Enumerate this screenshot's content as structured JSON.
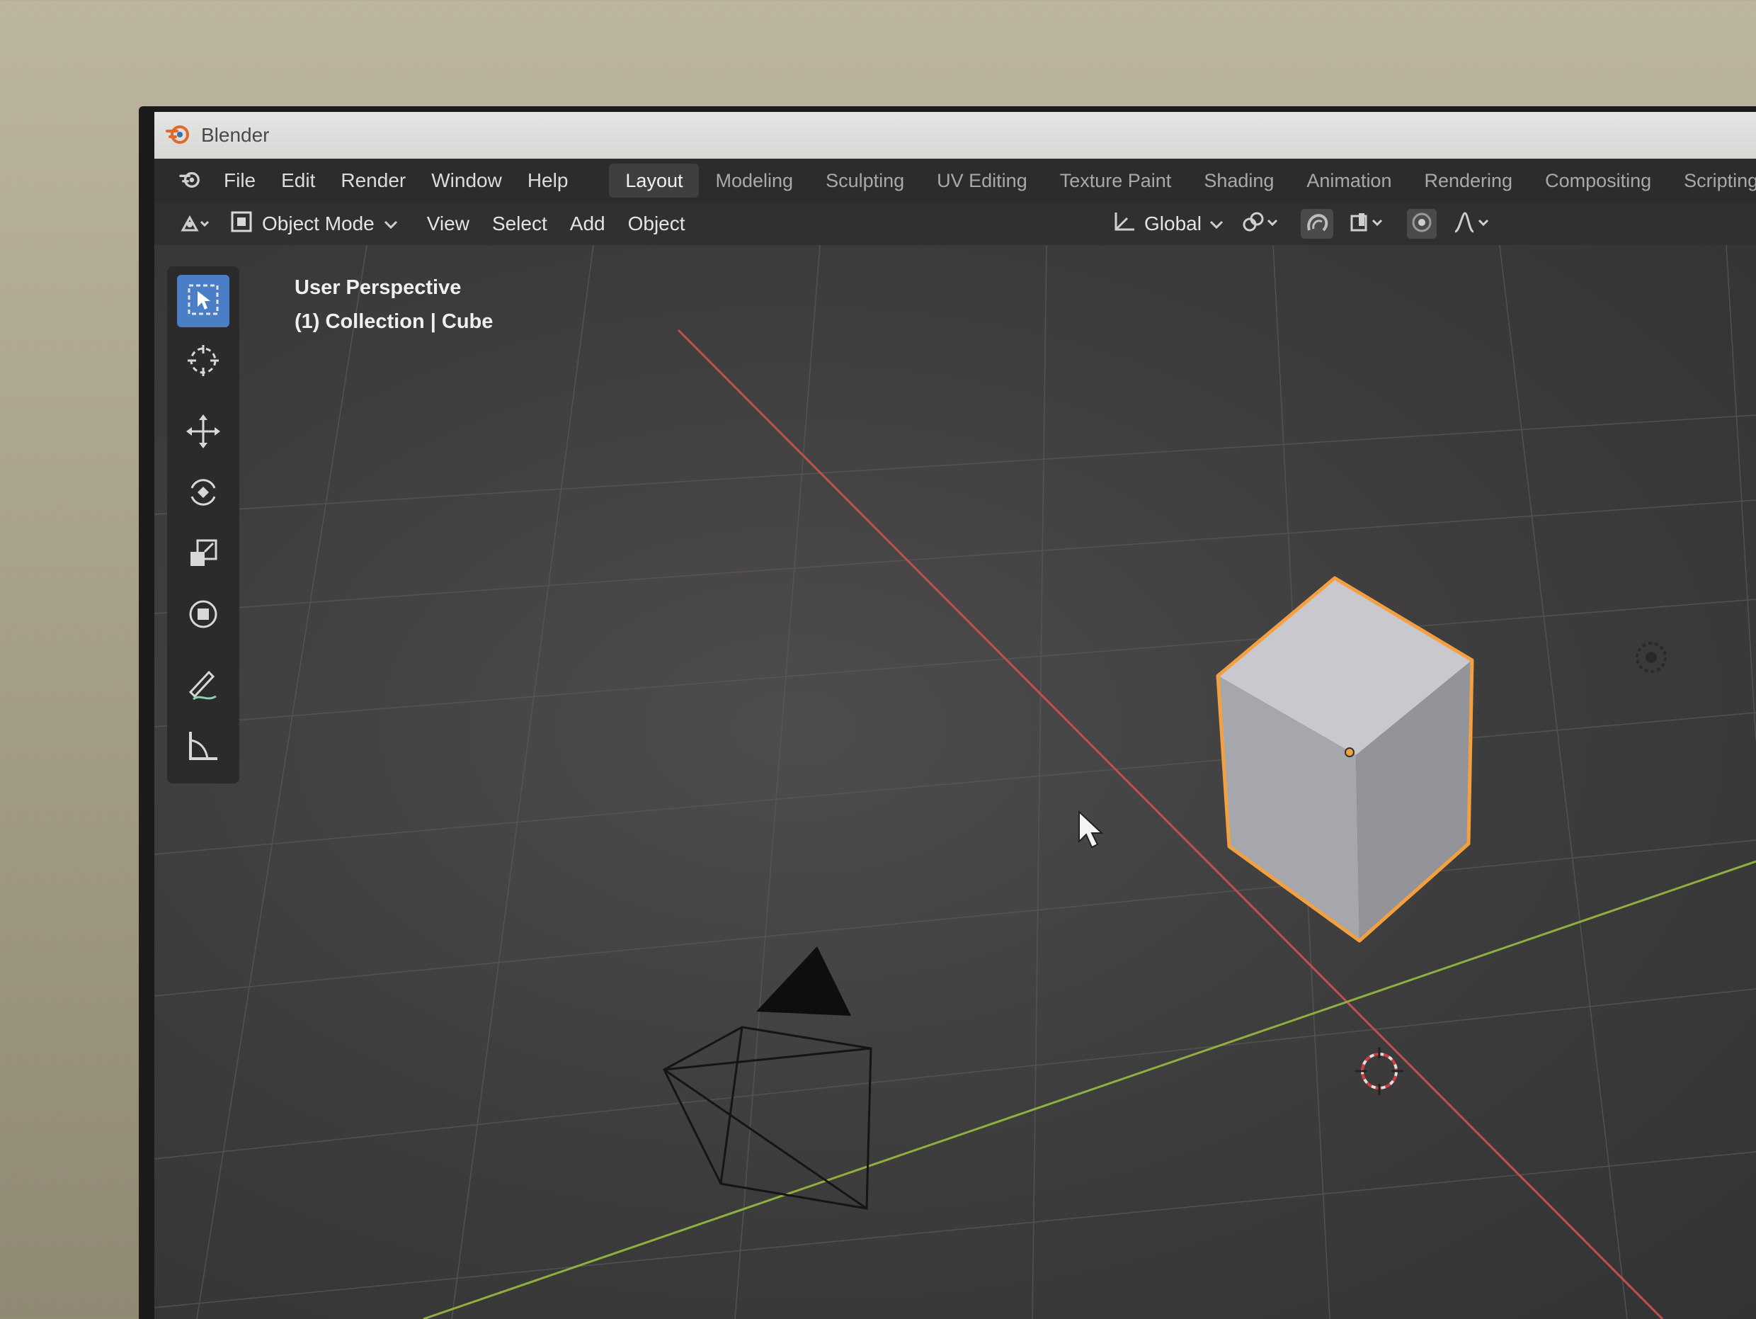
{
  "window": {
    "title": "Blender"
  },
  "menu": {
    "items": [
      "File",
      "Edit",
      "Render",
      "Window",
      "Help"
    ]
  },
  "workspaces": {
    "tabs": [
      "Layout",
      "Modeling",
      "Sculpting",
      "UV Editing",
      "Texture Paint",
      "Shading",
      "Animation",
      "Rendering",
      "Compositing",
      "Scripting"
    ],
    "active": "Layout"
  },
  "header": {
    "mode": "Object Mode",
    "view_label": "View",
    "select_label": "Select",
    "add_label": "Add",
    "object_label": "Object",
    "transform_orientation": "Global"
  },
  "viewport": {
    "perspective_label": "User Perspective",
    "collection_label": "(1) Collection | Cube"
  },
  "tools": [
    "select-box",
    "cursor",
    "move",
    "rotate",
    "scale",
    "transform",
    "annotate",
    "measure"
  ],
  "colors": {
    "accent": "#4a7fc7",
    "selection_outline": "#f5a040",
    "x_axis": "#c05050",
    "y_axis": "#8fb040"
  }
}
